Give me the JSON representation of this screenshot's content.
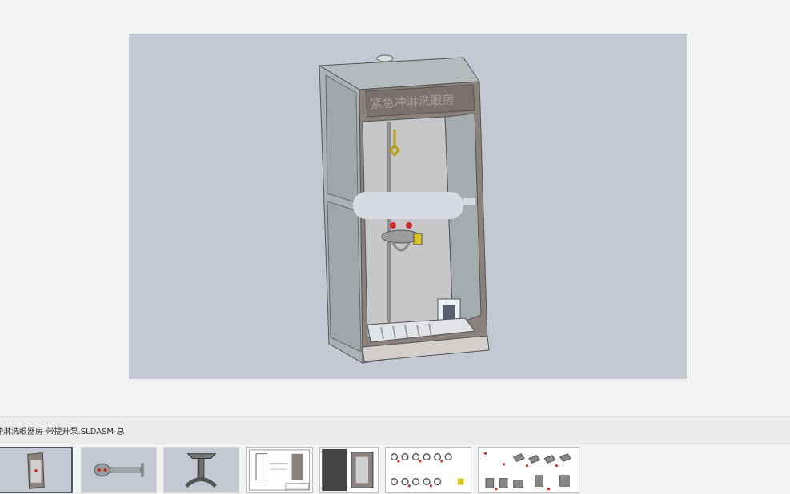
{
  "viewer": {
    "model_name": "shower-eyewash-booth",
    "sign_text": "紧急冲淋洗眼房"
  },
  "file_bar": {
    "title": "冲淋洗眼器房-带提升泵.SLDASM-总"
  },
  "thumbnails": [
    {
      "kind": "model",
      "subject": "booth"
    },
    {
      "kind": "model",
      "subject": "eyewash-arm"
    },
    {
      "kind": "model",
      "subject": "bracket"
    },
    {
      "kind": "drawing",
      "subject": "booth-drawing"
    },
    {
      "kind": "drawing",
      "subject": "booth-drawing-dark"
    },
    {
      "kind": "drawing",
      "subject": "parts-sheet-1"
    },
    {
      "kind": "drawing",
      "subject": "parts-sheet-2"
    }
  ],
  "colors": {
    "background": "#f3f3f3",
    "viewport": "#c4c8d3",
    "frame": "#7e7470",
    "glass": "#a8b0b2",
    "selection": "#505868"
  }
}
